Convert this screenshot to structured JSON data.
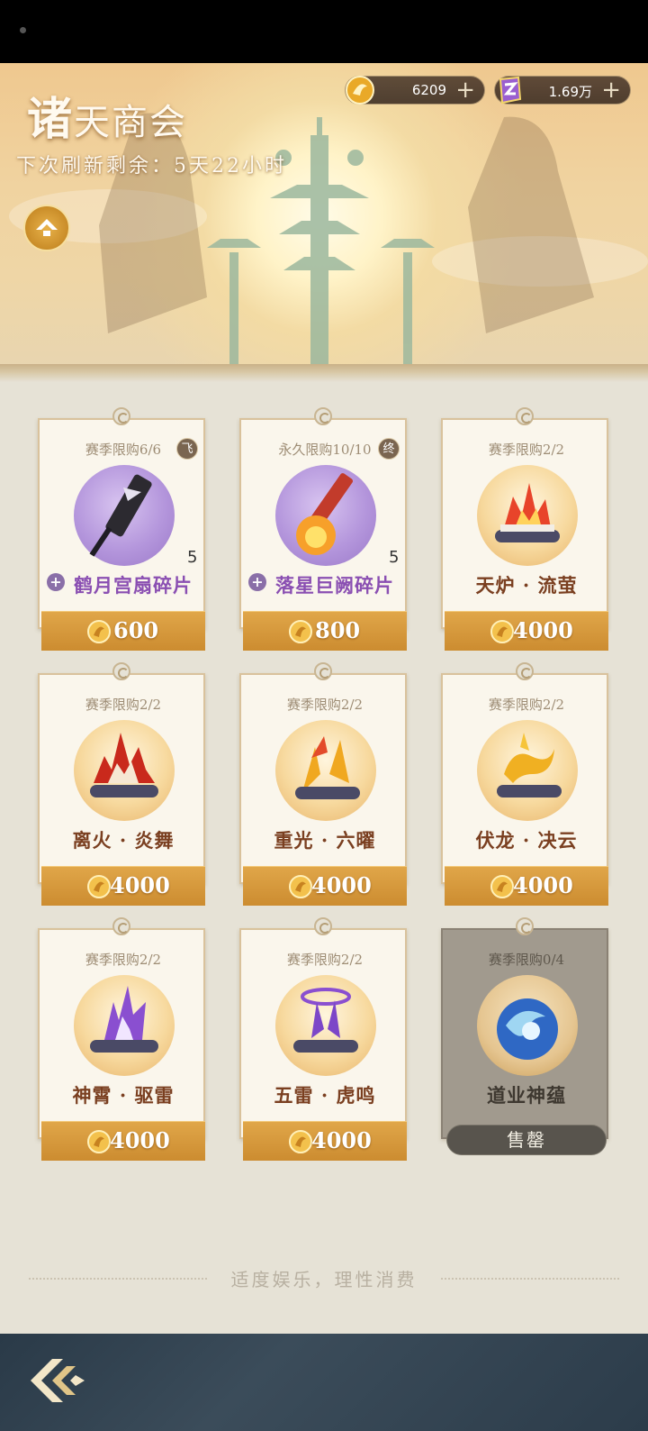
{
  "header": {
    "title_first": "诸",
    "title_rest": "天商会",
    "refresh_text": "下次刷新剩余：5天22小时"
  },
  "currencies": [
    {
      "icon": "gold-coin-icon",
      "value": "6209"
    },
    {
      "icon": "purple-crystal-icon",
      "value": "1.69万"
    }
  ],
  "shop": {
    "items": [
      {
        "limit": "赛季限购6/6",
        "badge": "飞",
        "name": "鹤月宫扇碎片",
        "count": "5",
        "price": "600",
        "style": "purple"
      },
      {
        "limit": "永久限购10/10",
        "badge": "终",
        "name": "落星巨阙碎片",
        "count": "5",
        "price": "800",
        "style": "purple"
      },
      {
        "limit": "赛季限购2/2",
        "name": "天炉 · 流萤",
        "price": "4000",
        "style": "gold"
      },
      {
        "limit": "赛季限购2/2",
        "name": "离火 · 炎舞",
        "price": "4000",
        "style": "gold"
      },
      {
        "limit": "赛季限购2/2",
        "name": "重光 · 六曜",
        "price": "4000",
        "style": "gold"
      },
      {
        "limit": "赛季限购2/2",
        "name": "伏龙 · 决云",
        "price": "4000",
        "style": "gold"
      },
      {
        "limit": "赛季限购2/2",
        "name": "神霄 · 驱雷",
        "price": "4000",
        "style": "gold"
      },
      {
        "limit": "赛季限购2/2",
        "name": "五雷 · 虎鸣",
        "price": "4000",
        "style": "gold"
      },
      {
        "limit": "赛季限购0/4",
        "name": "道业神蕴",
        "sold_out_label": "售罄",
        "style": "soldout"
      }
    ]
  },
  "footer": {
    "text": "适度娱乐，理性消费"
  },
  "colors": {
    "price_bar": "#d39a3c",
    "item_name": "#7a3f20",
    "fragment_name": "#8a4fb2",
    "page_bg": "#e6e2d6"
  }
}
